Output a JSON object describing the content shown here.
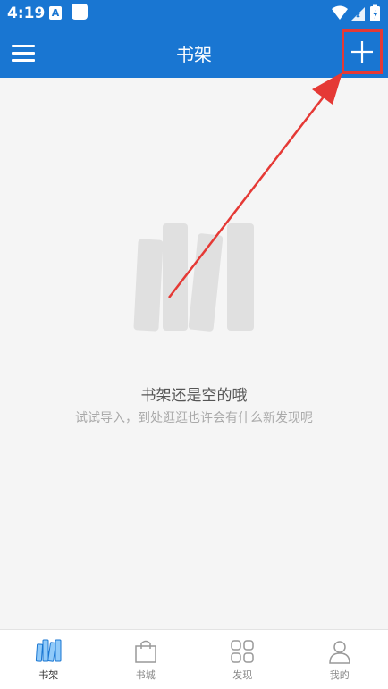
{
  "status_bar": {
    "time": "4:19",
    "notification_letter": "A"
  },
  "app_bar": {
    "title": "书架",
    "menu_icon": "hamburger-menu-icon",
    "add_icon": "plus-icon"
  },
  "empty_state": {
    "illustration_icon": "bookshelf-icon",
    "title": "书架还是空的哦",
    "subtitle": "试试导入，到处逛逛也许会有什么新发现呢"
  },
  "bottom_nav": {
    "items": [
      {
        "label": "书架",
        "icon": "bookshelf-icon",
        "active": true
      },
      {
        "label": "书城",
        "icon": "shopping-bag-icon",
        "active": false
      },
      {
        "label": "发现",
        "icon": "grid-icon",
        "active": false
      },
      {
        "label": "我的",
        "icon": "user-icon",
        "active": false
      }
    ]
  },
  "colors": {
    "primary": "#1976d2",
    "annotation_red": "#e53935",
    "background": "#f5f5f5",
    "active_icon": "#90caf9"
  }
}
